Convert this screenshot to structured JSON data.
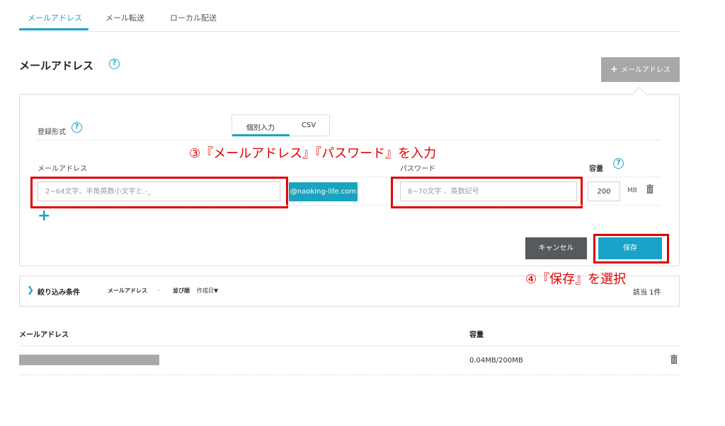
{
  "tabs": [
    {
      "label": "メールアドレス",
      "active": true
    },
    {
      "label": "メール転送",
      "active": false
    },
    {
      "label": "ローカル配送",
      "active": false
    }
  ],
  "page_title": "メールアドレス",
  "add_button_label": "メールアドレス",
  "form": {
    "registration_label": "登録形式",
    "modes": [
      "個別入力",
      "CSV"
    ],
    "email_label": "メールアドレス",
    "email_placeholder": "2~64文字、半角英数小文字と.-_",
    "domain": "@naoking-life.com",
    "password_label": "パスワード",
    "password_placeholder": "8~70文字 、英数記号",
    "capacity_label": "容量",
    "capacity_value": "200",
    "capacity_unit": "MB",
    "cancel_label": "キャンセル",
    "save_label": "保存"
  },
  "annotations": {
    "step3": "③『メールアドレス』『パスワード』を入力",
    "step4": "④『保存』を選択"
  },
  "filter": {
    "label": "絞り込み条件",
    "field": "メールアドレス",
    "dash": "-",
    "sort_label": "並び順",
    "sort_value": "作成日▼",
    "count": "該当 1件"
  },
  "table": {
    "headers": [
      "メールアドレス",
      "容量"
    ],
    "rows": [
      {
        "capacity": "0.04MB/200MB"
      }
    ]
  },
  "colors": {
    "accent": "#19a3c9",
    "annotation": "#e00000"
  },
  "icons": [
    "help-icon",
    "plus-icon",
    "trash-icon",
    "chevron-right-icon"
  ]
}
